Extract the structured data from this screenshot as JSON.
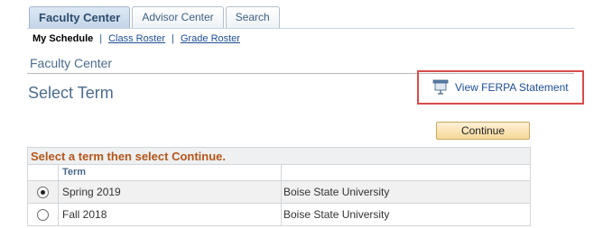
{
  "tabs": [
    {
      "label": "Faculty Center",
      "active": true
    },
    {
      "label": "Advisor Center",
      "active": false
    },
    {
      "label": "Search",
      "active": false
    }
  ],
  "subnav": {
    "current": "My Schedule",
    "separator": "|",
    "links": [
      "Class Roster",
      "Grade Roster"
    ]
  },
  "section_title": "Faculty Center",
  "page_title": "Select Term",
  "ferpa": {
    "label": "View FERPA Statement",
    "icon": "presentation-board-icon"
  },
  "continue_label": "Continue",
  "term_grid": {
    "caption": "Select a term then select Continue.",
    "column_header": "Term",
    "rows": [
      {
        "term": "Spring 2019",
        "institution": "Boise State University",
        "selected": true
      },
      {
        "term": "Fall 2018",
        "institution": "Boise State University",
        "selected": false
      }
    ]
  },
  "colors": {
    "tab_text": "#3d5f82",
    "link": "#1e4e93",
    "heading": "#4c6b8d",
    "caption": "#b4561a",
    "highlight_border": "#d84b4b",
    "button_bg": "#f6d899"
  }
}
